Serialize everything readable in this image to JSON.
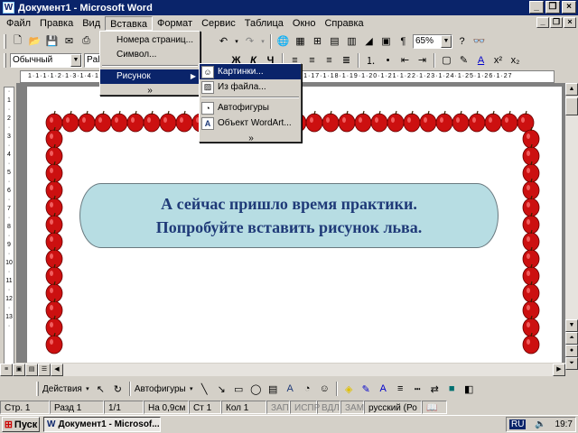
{
  "window": {
    "title": "Документ1 - Microsoft Word",
    "app_icon": "W"
  },
  "menu": [
    "Файл",
    "Правка",
    "Вид",
    "Вставка",
    "Формат",
    "Сервис",
    "Таблица",
    "Окно",
    "Справка"
  ],
  "toolbar": {
    "zoom": "65%",
    "style": "Обычный",
    "font": "Palatino"
  },
  "insert_menu": {
    "items": [
      "Номера страниц...",
      "Символ...",
      "Рисунок"
    ],
    "expand": "»"
  },
  "picture_submenu": {
    "items": [
      "Картинки...",
      "Из файла...",
      "Автофигуры",
      "Объект WordArt..."
    ],
    "expand": "»"
  },
  "document": {
    "callout_line1": "А сейчас пришло время практики.",
    "callout_line2": "Попробуйте вставить рисунок льва.",
    "border_color": "#cc1010",
    "callout_fill": "#b7dde3",
    "callout_text_color": "#1f3a78"
  },
  "ruler": {
    "text": "1·1·1·1·2·1·3·1·4·1·5·1·6·1·7·1·8·1·9·1·10·1·11·1·12·1·13·1·14·1·15·1·16·1·17·1·18·1·19·1·20·1·21·1·22·1·23·1·24·1·25·1·26·1·27"
  },
  "drawing": {
    "actions": "Действия",
    "autoshapes": "Автофигуры"
  },
  "status": {
    "page": "Стр. 1",
    "section": "Разд 1",
    "pages": "1/1",
    "pos": "На 0,9см",
    "line": "Ст 1",
    "col": "Кол 1",
    "rec": "ЗАП",
    "trk": "ИСПР",
    "ext": "ВДЛ",
    "ovr": "ЗАМ",
    "lang": "русский (Ро"
  },
  "taskbar": {
    "start": "Пуск",
    "task": "Документ1 - Microsof...",
    "lang": "RU",
    "time": "19:7"
  }
}
